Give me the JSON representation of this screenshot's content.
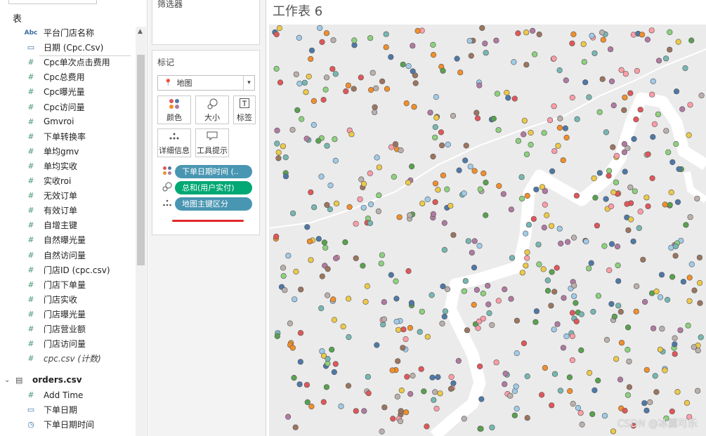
{
  "data_pane": {
    "tables_heading": "表",
    "fields_cpc": [
      {
        "type": "abc",
        "label": "平台门店名称",
        "italic": false
      },
      {
        "type": "date",
        "label": "日期 (Cpc.Csv)",
        "italic": false
      },
      {
        "type": "measure",
        "label": "Cpc单次点击费用",
        "italic": false
      },
      {
        "type": "measure",
        "label": "Cpc总费用",
        "italic": false
      },
      {
        "type": "measure",
        "label": "Cpc曝光量",
        "italic": false
      },
      {
        "type": "measure",
        "label": "Cpc访问量",
        "italic": false
      },
      {
        "type": "measure",
        "label": "Gmvroi",
        "italic": false
      },
      {
        "type": "measure",
        "label": "下单转换率",
        "italic": false
      },
      {
        "type": "measure",
        "label": "单均gmv",
        "italic": false
      },
      {
        "type": "measure",
        "label": "单均实收",
        "italic": false
      },
      {
        "type": "measure",
        "label": "实收roi",
        "italic": false
      },
      {
        "type": "measure",
        "label": "无效订单",
        "italic": false
      },
      {
        "type": "measure",
        "label": "有效订单",
        "italic": false
      },
      {
        "type": "measure",
        "label": "自增主键",
        "italic": false
      },
      {
        "type": "measure",
        "label": "自然曝光量",
        "italic": false
      },
      {
        "type": "measure",
        "label": "自然访问量",
        "italic": false
      },
      {
        "type": "measure",
        "label": "门店ID (cpc.csv)",
        "italic": false
      },
      {
        "type": "measure",
        "label": "门店下单量",
        "italic": false
      },
      {
        "type": "measure",
        "label": "门店实收",
        "italic": false
      },
      {
        "type": "measure",
        "label": "门店曝光量",
        "italic": false
      },
      {
        "type": "measure",
        "label": "门店营业额",
        "italic": false
      },
      {
        "type": "measure",
        "label": "门店访问量",
        "italic": false
      },
      {
        "type": "measure",
        "label": "cpc.csv (计数)",
        "italic": true
      }
    ],
    "orders_table": "orders.csv",
    "fields_orders": [
      {
        "type": "measure",
        "label": "Add Time",
        "italic": false
      },
      {
        "type": "date",
        "label": "下单日期",
        "italic": false
      },
      {
        "type": "datetime",
        "label": "下单日期时间",
        "italic": false
      }
    ]
  },
  "shelves": {
    "filters_title": "筛选器",
    "marks_title": "标记",
    "mark_type": "地图",
    "buttons": {
      "color": "颜色",
      "size": "大小",
      "label": "标签",
      "detail": "详细信息",
      "tooltip": "工具提示"
    },
    "pills": [
      {
        "kind": "color",
        "label": "下单日期时间 (..",
        "color": "#4996b2"
      },
      {
        "kind": "size",
        "label": "总和(用户实付)",
        "color": "#00a873"
      },
      {
        "kind": "detail",
        "label": "地图主键区分",
        "color": "#4996b2"
      }
    ]
  },
  "view": {
    "sheet_title": "工作表 6",
    "watermark": "CSDN @冰露可乐",
    "map_bg": "#ebebeb",
    "river_color": "#ffffff",
    "point_palette": [
      "#4e79a7",
      "#f28e2b",
      "#e15759",
      "#76b7b2",
      "#59a14f",
      "#edc948",
      "#b07aa1",
      "#ff9da7",
      "#9c755f",
      "#bab0ac",
      "#a0cbe8",
      "#8cd17d"
    ]
  }
}
